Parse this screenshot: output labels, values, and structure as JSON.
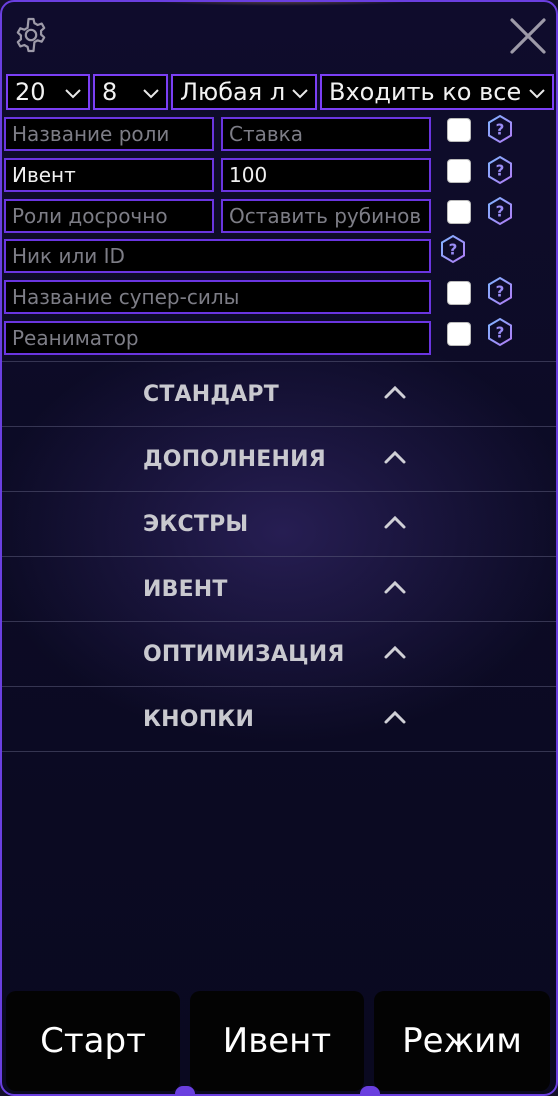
{
  "header": {
    "settings_icon": "gear-icon",
    "close_icon": "close-icon"
  },
  "selects": [
    {
      "value": "20"
    },
    {
      "value": "8"
    },
    {
      "value": "Любая л"
    },
    {
      "value": "Входить ко всем"
    }
  ],
  "form": {
    "role_name": {
      "placeholder": "Название роли",
      "value": ""
    },
    "bet": {
      "placeholder": "Ставка",
      "value": ""
    },
    "event_name": {
      "placeholder": "",
      "value": "Ивент"
    },
    "event_amount": {
      "placeholder": "",
      "value": "100"
    },
    "early_roles": {
      "placeholder": "Роли досрочно",
      "value": ""
    },
    "leave_rubies": {
      "placeholder": "Оставить рубинов",
      "value": ""
    },
    "nick_or_id": {
      "placeholder": "Ник или ID",
      "value": ""
    },
    "superpower": {
      "placeholder": "Название супер-силы",
      "value": ""
    },
    "reanimator": {
      "placeholder": "Реаниматор",
      "value": ""
    }
  },
  "sections": [
    {
      "label": "СТАНДАРТ"
    },
    {
      "label": "ДОПОЛНЕНИЯ"
    },
    {
      "label": "ЭКСТРЫ"
    },
    {
      "label": "ИВЕНТ"
    },
    {
      "label": "ОПТИМИЗАЦИЯ"
    },
    {
      "label": "КНОПКИ"
    }
  ],
  "buttons": {
    "start": "Старт",
    "event": "Ивент",
    "mode": "Режим"
  },
  "colors": {
    "accent": "#7b3ff5",
    "panel_bg": "#0e0c28",
    "help_icon": "#8a7cf0"
  }
}
